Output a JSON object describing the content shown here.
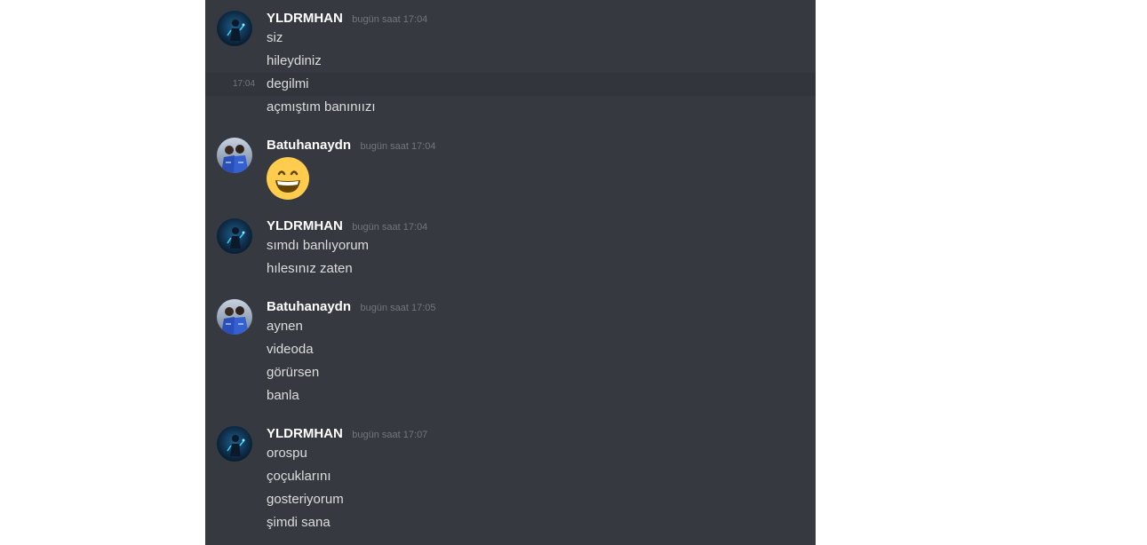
{
  "messages": [
    {
      "author": "YLDRMHAN",
      "timestamp": "bugün saat 17:04",
      "avatar": "dark-blue-figure",
      "lines": [
        "siz",
        "hileydiniz",
        "degilmi",
        "açmıştım banınıızı"
      ],
      "hover_time": "17:04"
    },
    {
      "author": "Batuhanaydn",
      "timestamp": "bugün saat 17:04",
      "avatar": "two-people-photo",
      "emoji": "grinning-face-emoji"
    },
    {
      "author": "YLDRMHAN",
      "timestamp": "bugün saat 17:04",
      "avatar": "dark-blue-figure",
      "lines": [
        "sımdı banlıyorum",
        "hılesınız zaten"
      ]
    },
    {
      "author": "Batuhanaydn",
      "timestamp": "bugün saat 17:05",
      "avatar": "two-people-photo",
      "lines": [
        "aynen",
        "videoda",
        "görürsen",
        "banla"
      ]
    },
    {
      "author": "YLDRMHAN",
      "timestamp": "bugün saat 17:07",
      "avatar": "dark-blue-figure",
      "lines": [
        "orospu",
        "çoçuklarını",
        "gosteriyorum",
        "şimdi sana"
      ]
    }
  ],
  "colors": {
    "background": "#36393f",
    "username": "#ffffff",
    "message_text": "#dcddde",
    "timestamp": "#72767d",
    "hover_row": "#32353b"
  }
}
